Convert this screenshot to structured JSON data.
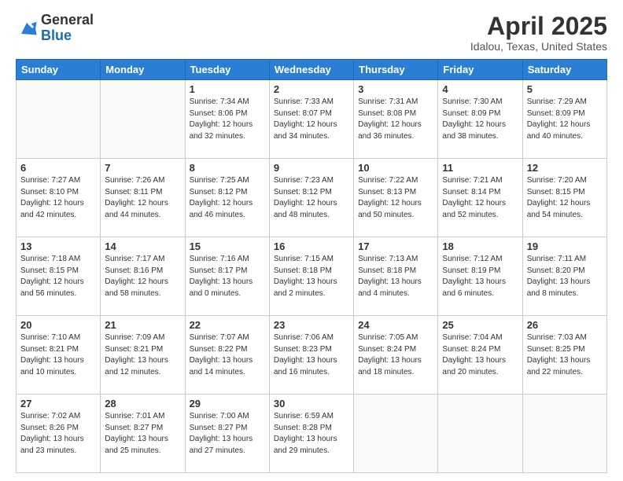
{
  "header": {
    "logo": {
      "general": "General",
      "blue": "Blue"
    },
    "title": "April 2025",
    "location": "Idalou, Texas, United States"
  },
  "days_of_week": [
    "Sunday",
    "Monday",
    "Tuesday",
    "Wednesday",
    "Thursday",
    "Friday",
    "Saturday"
  ],
  "weeks": [
    [
      {
        "day": "",
        "info": ""
      },
      {
        "day": "",
        "info": ""
      },
      {
        "day": "1",
        "info": "Sunrise: 7:34 AM\nSunset: 8:06 PM\nDaylight: 12 hours\nand 32 minutes."
      },
      {
        "day": "2",
        "info": "Sunrise: 7:33 AM\nSunset: 8:07 PM\nDaylight: 12 hours\nand 34 minutes."
      },
      {
        "day": "3",
        "info": "Sunrise: 7:31 AM\nSunset: 8:08 PM\nDaylight: 12 hours\nand 36 minutes."
      },
      {
        "day": "4",
        "info": "Sunrise: 7:30 AM\nSunset: 8:09 PM\nDaylight: 12 hours\nand 38 minutes."
      },
      {
        "day": "5",
        "info": "Sunrise: 7:29 AM\nSunset: 8:09 PM\nDaylight: 12 hours\nand 40 minutes."
      }
    ],
    [
      {
        "day": "6",
        "info": "Sunrise: 7:27 AM\nSunset: 8:10 PM\nDaylight: 12 hours\nand 42 minutes."
      },
      {
        "day": "7",
        "info": "Sunrise: 7:26 AM\nSunset: 8:11 PM\nDaylight: 12 hours\nand 44 minutes."
      },
      {
        "day": "8",
        "info": "Sunrise: 7:25 AM\nSunset: 8:12 PM\nDaylight: 12 hours\nand 46 minutes."
      },
      {
        "day": "9",
        "info": "Sunrise: 7:23 AM\nSunset: 8:12 PM\nDaylight: 12 hours\nand 48 minutes."
      },
      {
        "day": "10",
        "info": "Sunrise: 7:22 AM\nSunset: 8:13 PM\nDaylight: 12 hours\nand 50 minutes."
      },
      {
        "day": "11",
        "info": "Sunrise: 7:21 AM\nSunset: 8:14 PM\nDaylight: 12 hours\nand 52 minutes."
      },
      {
        "day": "12",
        "info": "Sunrise: 7:20 AM\nSunset: 8:15 PM\nDaylight: 12 hours\nand 54 minutes."
      }
    ],
    [
      {
        "day": "13",
        "info": "Sunrise: 7:18 AM\nSunset: 8:15 PM\nDaylight: 12 hours\nand 56 minutes."
      },
      {
        "day": "14",
        "info": "Sunrise: 7:17 AM\nSunset: 8:16 PM\nDaylight: 12 hours\nand 58 minutes."
      },
      {
        "day": "15",
        "info": "Sunrise: 7:16 AM\nSunset: 8:17 PM\nDaylight: 13 hours\nand 0 minutes."
      },
      {
        "day": "16",
        "info": "Sunrise: 7:15 AM\nSunset: 8:18 PM\nDaylight: 13 hours\nand 2 minutes."
      },
      {
        "day": "17",
        "info": "Sunrise: 7:13 AM\nSunset: 8:18 PM\nDaylight: 13 hours\nand 4 minutes."
      },
      {
        "day": "18",
        "info": "Sunrise: 7:12 AM\nSunset: 8:19 PM\nDaylight: 13 hours\nand 6 minutes."
      },
      {
        "day": "19",
        "info": "Sunrise: 7:11 AM\nSunset: 8:20 PM\nDaylight: 13 hours\nand 8 minutes."
      }
    ],
    [
      {
        "day": "20",
        "info": "Sunrise: 7:10 AM\nSunset: 8:21 PM\nDaylight: 13 hours\nand 10 minutes."
      },
      {
        "day": "21",
        "info": "Sunrise: 7:09 AM\nSunset: 8:21 PM\nDaylight: 13 hours\nand 12 minutes."
      },
      {
        "day": "22",
        "info": "Sunrise: 7:07 AM\nSunset: 8:22 PM\nDaylight: 13 hours\nand 14 minutes."
      },
      {
        "day": "23",
        "info": "Sunrise: 7:06 AM\nSunset: 8:23 PM\nDaylight: 13 hours\nand 16 minutes."
      },
      {
        "day": "24",
        "info": "Sunrise: 7:05 AM\nSunset: 8:24 PM\nDaylight: 13 hours\nand 18 minutes."
      },
      {
        "day": "25",
        "info": "Sunrise: 7:04 AM\nSunset: 8:24 PM\nDaylight: 13 hours\nand 20 minutes."
      },
      {
        "day": "26",
        "info": "Sunrise: 7:03 AM\nSunset: 8:25 PM\nDaylight: 13 hours\nand 22 minutes."
      }
    ],
    [
      {
        "day": "27",
        "info": "Sunrise: 7:02 AM\nSunset: 8:26 PM\nDaylight: 13 hours\nand 23 minutes."
      },
      {
        "day": "28",
        "info": "Sunrise: 7:01 AM\nSunset: 8:27 PM\nDaylight: 13 hours\nand 25 minutes."
      },
      {
        "day": "29",
        "info": "Sunrise: 7:00 AM\nSunset: 8:27 PM\nDaylight: 13 hours\nand 27 minutes."
      },
      {
        "day": "30",
        "info": "Sunrise: 6:59 AM\nSunset: 8:28 PM\nDaylight: 13 hours\nand 29 minutes."
      },
      {
        "day": "",
        "info": ""
      },
      {
        "day": "",
        "info": ""
      },
      {
        "day": "",
        "info": ""
      }
    ]
  ]
}
